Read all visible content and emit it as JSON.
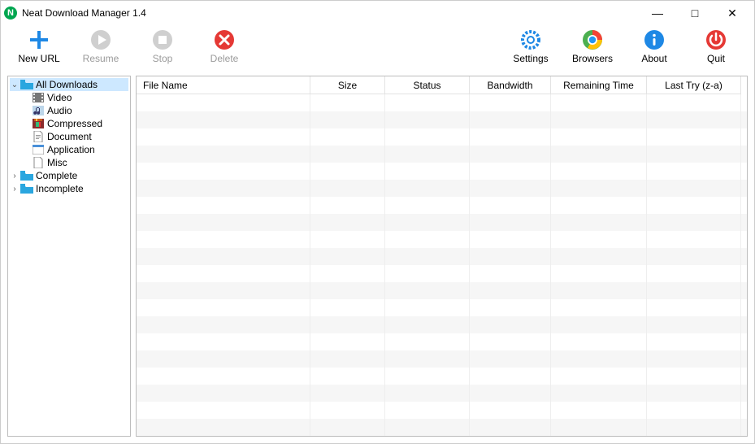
{
  "titlebar": {
    "title": "Neat Download Manager 1.4"
  },
  "toolbar": {
    "left": [
      {
        "id": "new-url",
        "label": "New URL",
        "icon": "plus-icon",
        "color": "#1e88e5",
        "enabled": true
      },
      {
        "id": "resume",
        "label": "Resume",
        "icon": "play-icon",
        "color": "#bfbfbf",
        "enabled": false
      },
      {
        "id": "stop",
        "label": "Stop",
        "icon": "stop-icon",
        "color": "#bfbfbf",
        "enabled": false
      },
      {
        "id": "delete",
        "label": "Delete",
        "icon": "delete-icon",
        "color": "#e53935",
        "enabled": false
      }
    ],
    "right": [
      {
        "id": "settings",
        "label": "Settings",
        "icon": "gear-icon",
        "color": "#1e88e5",
        "enabled": true
      },
      {
        "id": "browsers",
        "label": "Browsers",
        "icon": "chrome-icon",
        "color": "#1e88e5",
        "enabled": true
      },
      {
        "id": "about",
        "label": "About",
        "icon": "info-icon",
        "color": "#1e88e5",
        "enabled": true
      },
      {
        "id": "quit",
        "label": "Quit",
        "icon": "power-icon",
        "color": "#e53935",
        "enabled": true
      }
    ]
  },
  "tree": {
    "nodes": [
      {
        "label": "All Downloads",
        "expanded": true,
        "selected": true,
        "children": [
          {
            "label": "Video",
            "icon": "video-icon"
          },
          {
            "label": "Audio",
            "icon": "audio-icon"
          },
          {
            "label": "Compressed",
            "icon": "archive-icon"
          },
          {
            "label": "Document",
            "icon": "document-icon"
          },
          {
            "label": "Application",
            "icon": "application-icon"
          },
          {
            "label": "Misc",
            "icon": "misc-icon"
          }
        ]
      },
      {
        "label": "Complete",
        "expanded": false,
        "children": []
      },
      {
        "label": "Incomplete",
        "expanded": false,
        "children": []
      }
    ]
  },
  "table": {
    "columns": [
      {
        "id": "file",
        "label": "File Name",
        "align": "left"
      },
      {
        "id": "size",
        "label": "Size",
        "align": "center"
      },
      {
        "id": "status",
        "label": "Status",
        "align": "center"
      },
      {
        "id": "bw",
        "label": "Bandwidth",
        "align": "center"
      },
      {
        "id": "rem",
        "label": "Remaining Time",
        "align": "center"
      },
      {
        "id": "last",
        "label": "Last Try (z-a)",
        "align": "center"
      }
    ],
    "rows": []
  }
}
